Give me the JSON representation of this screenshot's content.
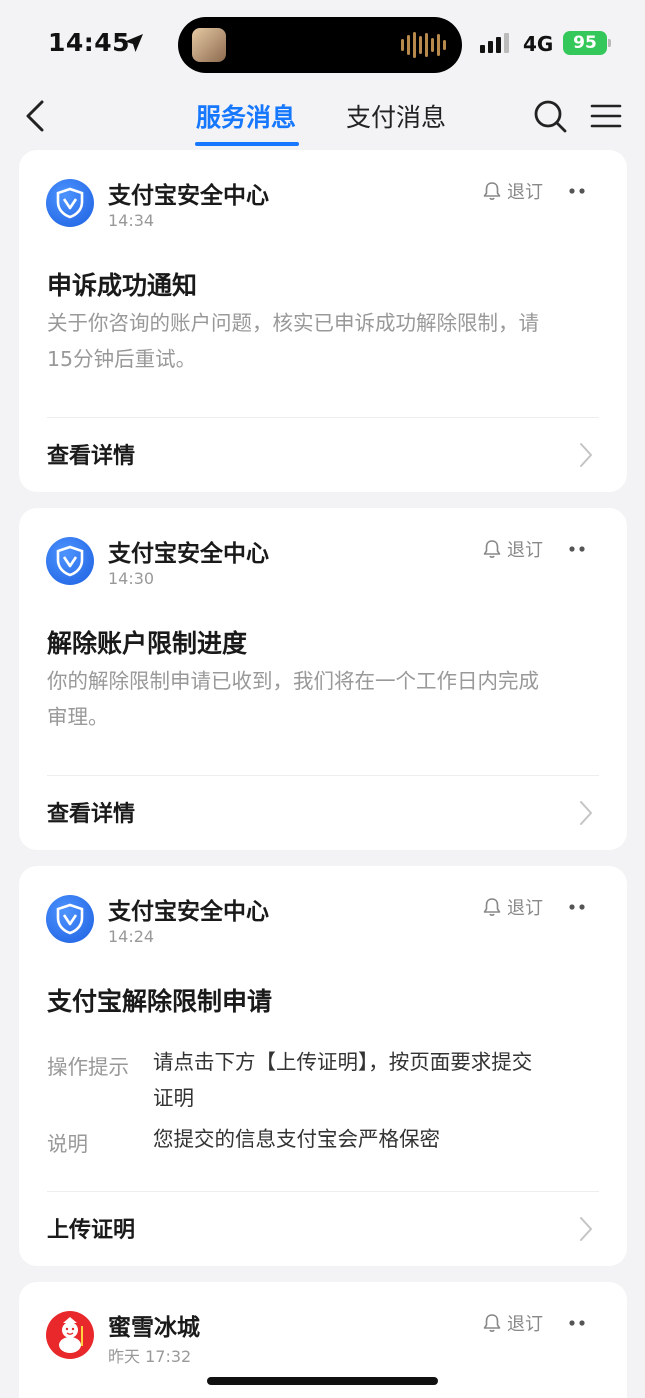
{
  "status_bar": {
    "time": "14:45",
    "network": "4G",
    "battery": "95"
  },
  "nav": {
    "tabs": [
      {
        "label": "服务消息",
        "active": true
      },
      {
        "label": "支付消息",
        "active": false
      }
    ],
    "accent_color": "#1677ff"
  },
  "cards": [
    {
      "sender": "支付宝安全中心",
      "time": "14:34",
      "unsubscribe": "退订",
      "title": "申诉成功通知",
      "body_lines": [
        "关于你咨询的账户问题，核实已申诉成功解除限制，请",
        "15分钟后重试。"
      ],
      "action": "查看详情"
    },
    {
      "sender": "支付宝安全中心",
      "time": "14:30",
      "unsubscribe": "退订",
      "title": "解除账户限制进度",
      "body_lines": [
        "你的解除限制申请已收到，我们将在一个工作日内完成",
        "审理。"
      ],
      "action": "查看详情"
    },
    {
      "sender": "支付宝安全中心",
      "time": "14:24",
      "unsubscribe": "退订",
      "title": "支付宝解除限制申请",
      "details": [
        {
          "key": "操作提示",
          "value_lines": [
            "请点击下方【上传证明】，按页面要求提交",
            "证明"
          ]
        },
        {
          "key": "说明",
          "value_lines": [
            "您提交的信息支付宝会严格保密"
          ]
        }
      ],
      "action": "上传证明"
    },
    {
      "sender": "蜜雪冰城",
      "time": "昨天 17:32",
      "unsubscribe": "退订"
    }
  ]
}
